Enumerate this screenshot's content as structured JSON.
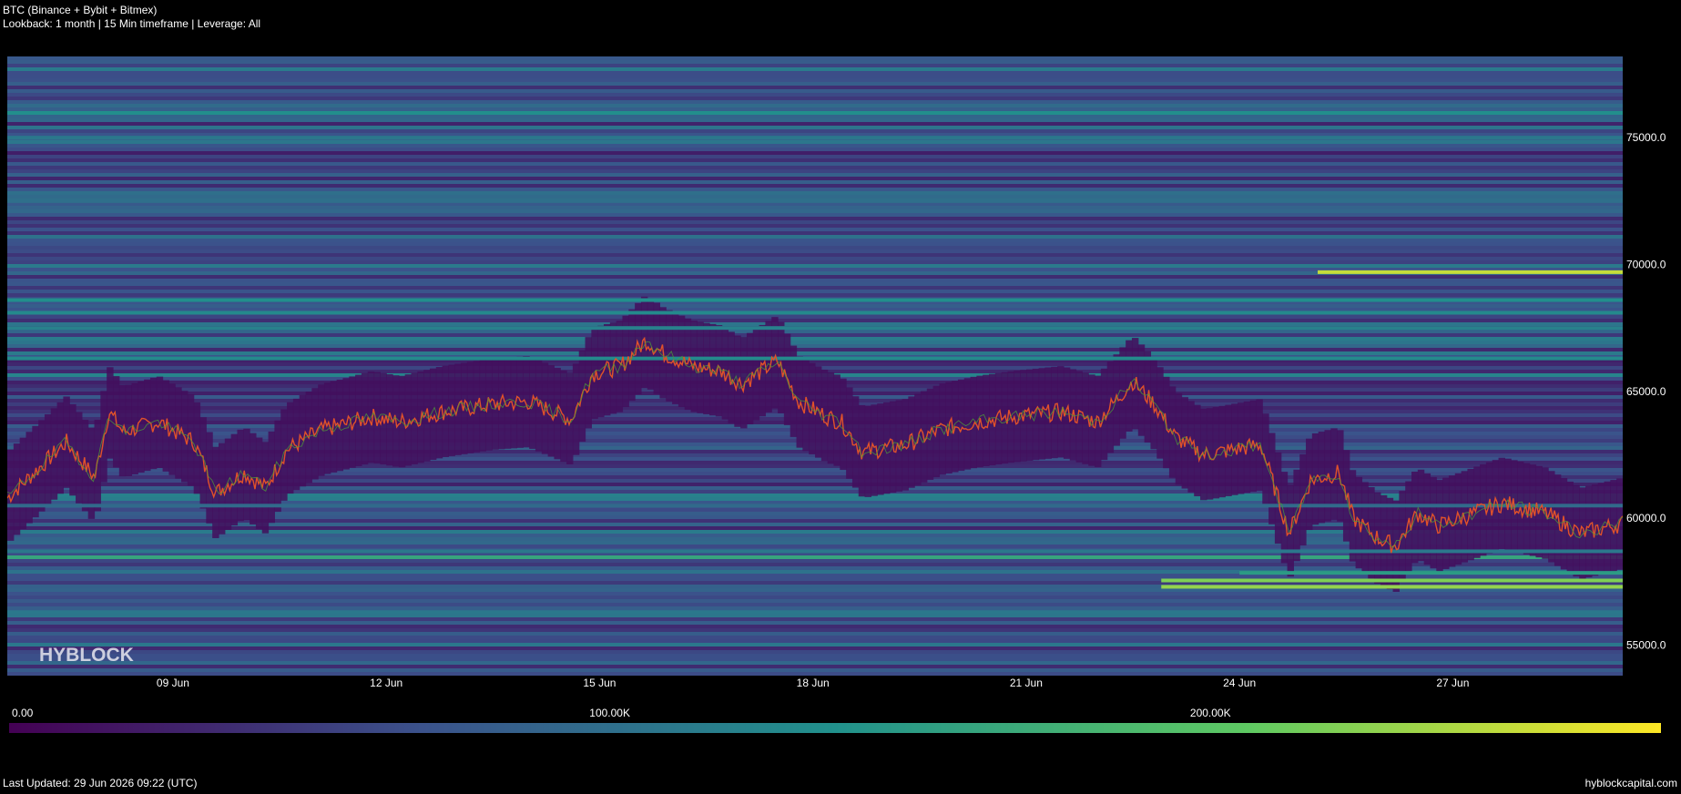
{
  "header": {
    "title": "BTC (Binance + Bybit + Bitmex)",
    "subtitle": "Lookback: 1 month | 15 Min timeframe | Leverage: All"
  },
  "footer": {
    "last_updated": "Last Updated: 29 Jun 2026 09:22 (UTC)",
    "site": "hyblockcapital.com"
  },
  "watermark": "HYBLOCK",
  "colorbar": {
    "tick_labels": [
      "0.00",
      "100.00K",
      "200.00K"
    ],
    "tick_values": [
      0,
      100000,
      200000
    ],
    "max": 275000,
    "colors": [
      "#440154",
      "#3b528b",
      "#21918c",
      "#5ec962",
      "#fde725"
    ]
  },
  "chart_data": {
    "type": "heatmap",
    "x_ticks": [
      "09 Jun",
      "12 Jun",
      "15 Jun",
      "18 Jun",
      "21 Jun",
      "24 Jun",
      "27 Jun"
    ],
    "x_tick_days": [
      9,
      12,
      15,
      18,
      21,
      24,
      27
    ],
    "xlim_days": [
      6.67,
      29.39
    ],
    "y_ticks": [
      "55000.0",
      "60000.0",
      "65000.0",
      "70000.0",
      "75000.0"
    ],
    "y_tick_values": [
      55000,
      60000,
      65000,
      70000,
      75000
    ],
    "ylim": [
      53800,
      78200
    ],
    "price_series": {
      "days": [
        6.67,
        7.2,
        7.5,
        7.9,
        8.1,
        8.3,
        8.8,
        9.3,
        9.6,
        10.0,
        10.3,
        10.6,
        11.1,
        11.4,
        11.8,
        12.2,
        12.8,
        13.5,
        14.0,
        14.6,
        14.9,
        15.3,
        15.65,
        15.9,
        16.3,
        16.7,
        17.0,
        17.5,
        17.8,
        18.2,
        18.4,
        18.7,
        19.3,
        19.8,
        20.3,
        20.8,
        21.5,
        22.0,
        22.5,
        22.8,
        23.1,
        23.5,
        23.9,
        24.3,
        24.7,
        25.0,
        25.4,
        25.6,
        25.95,
        26.2,
        26.5,
        26.8,
        27.3,
        27.7,
        28.3,
        28.8,
        29.39
      ],
      "prices": [
        60800,
        62200,
        63000,
        61600,
        64200,
        63400,
        63800,
        63000,
        61000,
        61800,
        61200,
        62700,
        63500,
        63700,
        64000,
        63800,
        64200,
        64500,
        64600,
        63900,
        65700,
        66000,
        67000,
        66500,
        66000,
        65800,
        65300,
        66200,
        64600,
        64000,
        63800,
        62600,
        62900,
        63500,
        63800,
        64000,
        64200,
        63800,
        65400,
        64500,
        63200,
        62500,
        62700,
        62900,
        59400,
        61500,
        61800,
        60000,
        59200,
        58900,
        60200,
        59700,
        60200,
        60600,
        60200,
        59400,
        59800
      ]
    },
    "liquidation_bands": [
      {
        "price": 57300,
        "start_day": 22.9,
        "value": 230000
      },
      {
        "price": 57550,
        "start_day": 22.9,
        "value": 220000
      },
      {
        "price": 57850,
        "start_day": 24.0,
        "value": 150000
      },
      {
        "price": 58700,
        "start_day": 6.67,
        "value": 110000
      },
      {
        "price": 69700,
        "start_day": 25.1,
        "value": 250000
      },
      {
        "price": 68600,
        "start_day": 6.67,
        "value": 135000
      },
      {
        "price": 68100,
        "start_day": 6.67,
        "value": 130000
      },
      {
        "price": 67500,
        "start_day": 6.67,
        "value": 120000
      },
      {
        "price": 66300,
        "start_day": 6.67,
        "value": 130000
      },
      {
        "price": 75000,
        "start_day": 6.67,
        "value": 110000
      },
      {
        "price": 72500,
        "start_day": 6.67,
        "value": 100000
      },
      {
        "price": 60500,
        "start_day": 6.67,
        "value": 95000
      },
      {
        "price": 56300,
        "start_day": 6.67,
        "value": 110000
      }
    ]
  }
}
